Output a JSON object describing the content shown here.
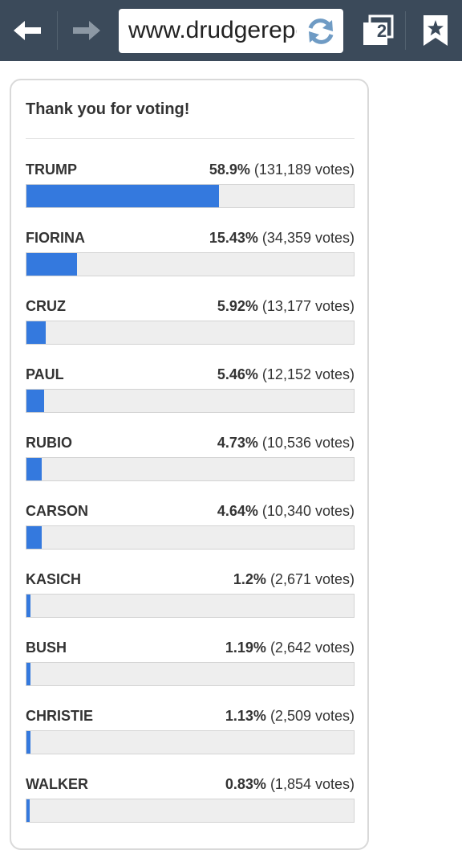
{
  "browser": {
    "url": "www.drudgerepo",
    "tab_count": "2"
  },
  "poll": {
    "heading": "Thank you for voting!",
    "accent_color": "#3479de",
    "results": [
      {
        "name": "TRUMP",
        "percent": "58.9%",
        "votes": "(131,189 votes)",
        "share": 0.589
      },
      {
        "name": "FIORINA",
        "percent": "15.43%",
        "votes": "(34,359 votes)",
        "share": 0.1543
      },
      {
        "name": "CRUZ",
        "percent": "5.92%",
        "votes": "(13,177 votes)",
        "share": 0.0592
      },
      {
        "name": "PAUL",
        "percent": "5.46%",
        "votes": "(12,152 votes)",
        "share": 0.0546
      },
      {
        "name": "RUBIO",
        "percent": "4.73%",
        "votes": "(10,536 votes)",
        "share": 0.0473
      },
      {
        "name": "CARSON",
        "percent": "4.64%",
        "votes": "(10,340 votes)",
        "share": 0.0464
      },
      {
        "name": "KASICH",
        "percent": "1.2%",
        "votes": "(2,671 votes)",
        "share": 0.012
      },
      {
        "name": "BUSH",
        "percent": "1.19%",
        "votes": "(2,642 votes)",
        "share": 0.0119
      },
      {
        "name": "CHRISTIE",
        "percent": "1.13%",
        "votes": "(2,509 votes)",
        "share": 0.0113
      },
      {
        "name": "WALKER",
        "percent": "0.83%",
        "votes": "(1,854 votes)",
        "share": 0.0083
      }
    ]
  }
}
